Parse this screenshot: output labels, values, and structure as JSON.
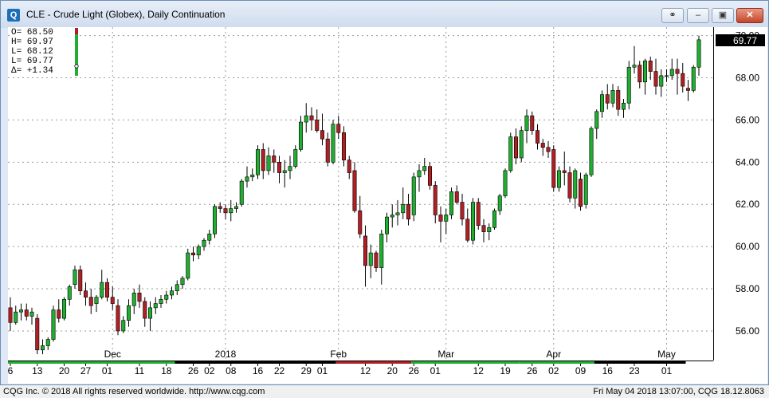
{
  "window": {
    "title": "CLE - Crude Light (Globex), Daily Continuation",
    "app_icon_glyph": "Q",
    "buttons": [
      "link-icon",
      "minimize-icon",
      "restore-icon",
      "close-icon"
    ]
  },
  "ohlc_box": {
    "lines": [
      "O=  68.50",
      "H=  69.97",
      "L=  68.12",
      "L=  69.77",
      "Δ=  +1.34"
    ]
  },
  "last_price": "69.77",
  "status": {
    "left": "CQG Inc. © 2018 All rights reserved worldwide. http://www.cqg.com",
    "right": "Fri May 04 2018 13:07:00, CQG 18.12.8063"
  },
  "colors": {
    "up": "#1fae2f",
    "down": "#b01f24",
    "wick": "#000000",
    "grid": "#9a9a9a"
  },
  "chart_data": {
    "type": "candlestick",
    "symbol": "CLE",
    "ylim": [
      54.6,
      70.4
    ],
    "y_ticks": [
      "56.00",
      "58.00",
      "60.00",
      "62.00",
      "64.00",
      "66.00",
      "68.00",
      "70.00"
    ],
    "month_labels": [
      {
        "label": "Dec",
        "bar": 19
      },
      {
        "label": "2018",
        "bar": 40
      },
      {
        "label": "Feb",
        "bar": 61
      },
      {
        "label": "Mar",
        "bar": 81
      },
      {
        "label": "Apr",
        "bar": 101
      },
      {
        "label": "May",
        "bar": 122
      }
    ],
    "day_labels": [
      {
        "label": "6",
        "bar": 0
      },
      {
        "label": "13",
        "bar": 5
      },
      {
        "label": "20",
        "bar": 10
      },
      {
        "label": "27",
        "bar": 14
      },
      {
        "label": "01",
        "bar": 18
      },
      {
        "label": "11",
        "bar": 24
      },
      {
        "label": "18",
        "bar": 29
      },
      {
        "label": "26",
        "bar": 34
      },
      {
        "label": "02",
        "bar": 37
      },
      {
        "label": "08",
        "bar": 41
      },
      {
        "label": "16",
        "bar": 46
      },
      {
        "label": "22",
        "bar": 50
      },
      {
        "label": "29",
        "bar": 55
      },
      {
        "label": "01",
        "bar": 58
      },
      {
        "label": "12",
        "bar": 66
      },
      {
        "label": "20",
        "bar": 71
      },
      {
        "label": "26",
        "bar": 75
      },
      {
        "label": "01",
        "bar": 79
      },
      {
        "label": "12",
        "bar": 87
      },
      {
        "label": "19",
        "bar": 92
      },
      {
        "label": "26",
        "bar": 97
      },
      {
        "label": "02",
        "bar": 101
      },
      {
        "label": "09",
        "bar": 106
      },
      {
        "label": "16",
        "bar": 111
      },
      {
        "label": "23",
        "bar": 116
      },
      {
        "label": "01",
        "bar": 122
      }
    ],
    "candles": [
      [
        57.1,
        57.6,
        56.0,
        56.4
      ],
      [
        56.4,
        57.2,
        56.3,
        56.9
      ],
      [
        56.9,
        57.3,
        56.5,
        57.0
      ],
      [
        57.0,
        57.3,
        56.5,
        56.7
      ],
      [
        56.7,
        57.1,
        56.3,
        56.9
      ],
      [
        56.6,
        56.8,
        54.9,
        55.1
      ],
      [
        55.1,
        55.6,
        54.9,
        55.3
      ],
      [
        55.3,
        55.7,
        55.1,
        55.6
      ],
      [
        55.6,
        57.2,
        55.5,
        57.0
      ],
      [
        57.0,
        57.5,
        56.4,
        56.6
      ],
      [
        56.6,
        57.6,
        56.5,
        57.5
      ],
      [
        57.5,
        58.2,
        57.2,
        58.1
      ],
      [
        58.2,
        59.1,
        58.0,
        58.9
      ],
      [
        58.9,
        59.1,
        57.7,
        57.9
      ],
      [
        57.9,
        58.3,
        57.2,
        57.6
      ],
      [
        57.6,
        58.0,
        56.8,
        57.2
      ],
      [
        57.3,
        57.7,
        56.9,
        57.6
      ],
      [
        57.6,
        58.9,
        57.5,
        58.3
      ],
      [
        58.3,
        58.5,
        57.4,
        57.6
      ],
      [
        57.6,
        58.1,
        57.0,
        57.3
      ],
      [
        57.2,
        57.5,
        55.8,
        56.0
      ],
      [
        56.0,
        56.7,
        55.9,
        56.5
      ],
      [
        56.5,
        57.5,
        56.2,
        57.2
      ],
      [
        57.2,
        58.0,
        56.8,
        57.8
      ],
      [
        57.8,
        58.2,
        57.1,
        57.4
      ],
      [
        57.4,
        57.6,
        56.2,
        56.6
      ],
      [
        56.6,
        57.4,
        56.0,
        57.1
      ],
      [
        57.1,
        57.6,
        56.8,
        57.3
      ],
      [
        57.3,
        57.7,
        57.1,
        57.5
      ],
      [
        57.5,
        57.9,
        57.3,
        57.7
      ],
      [
        57.7,
        58.1,
        57.5,
        57.9
      ],
      [
        57.9,
        58.4,
        57.7,
        58.2
      ],
      [
        58.2,
        58.6,
        58.0,
        58.5
      ],
      [
        58.5,
        59.9,
        58.4,
        59.7
      ],
      [
        59.7,
        60.0,
        59.3,
        59.6
      ],
      [
        59.6,
        60.1,
        59.4,
        60.0
      ],
      [
        60.0,
        60.4,
        59.8,
        60.3
      ],
      [
        60.3,
        60.8,
        60.1,
        60.6
      ],
      [
        60.6,
        62.0,
        60.4,
        61.9
      ],
      [
        61.9,
        62.1,
        61.6,
        61.8
      ],
      [
        61.8,
        62.0,
        61.3,
        61.6
      ],
      [
        61.6,
        62.2,
        61.2,
        61.8
      ],
      [
        61.8,
        62.1,
        61.6,
        61.9
      ],
      [
        62.0,
        63.2,
        61.9,
        63.1
      ],
      [
        63.1,
        63.8,
        62.8,
        63.3
      ],
      [
        63.3,
        63.7,
        63.1,
        63.4
      ],
      [
        63.4,
        64.8,
        63.2,
        64.6
      ],
      [
        64.6,
        64.9,
        63.2,
        63.6
      ],
      [
        63.6,
        64.7,
        63.4,
        64.3
      ],
      [
        64.3,
        64.6,
        63.5,
        64.0
      ],
      [
        64.0,
        64.3,
        63.0,
        63.5
      ],
      [
        63.5,
        64.1,
        62.8,
        63.6
      ],
      [
        63.6,
        64.3,
        63.2,
        63.8
      ],
      [
        63.8,
        64.8,
        63.7,
        64.6
      ],
      [
        64.6,
        66.2,
        64.5,
        65.9
      ],
      [
        65.9,
        66.8,
        65.4,
        66.2
      ],
      [
        66.2,
        66.6,
        65.5,
        66.0
      ],
      [
        66.0,
        66.5,
        65.4,
        65.5
      ],
      [
        65.5,
        66.3,
        64.8,
        65.1
      ],
      [
        65.1,
        65.4,
        63.8,
        64.0
      ],
      [
        64.0,
        66.0,
        63.9,
        65.8
      ],
      [
        65.8,
        66.2,
        65.1,
        65.4
      ],
      [
        65.4,
        65.7,
        63.8,
        64.1
      ],
      [
        64.1,
        64.3,
        63.2,
        63.5
      ],
      [
        63.6,
        64.0,
        61.6,
        61.7
      ],
      [
        61.7,
        62.4,
        60.4,
        60.6
      ],
      [
        60.5,
        61.0,
        58.1,
        59.1
      ],
      [
        59.1,
        60.1,
        58.5,
        59.7
      ],
      [
        59.7,
        59.8,
        58.8,
        59.0
      ],
      [
        59.0,
        60.8,
        58.2,
        60.6
      ],
      [
        60.6,
        61.6,
        60.2,
        61.4
      ],
      [
        61.4,
        62.0,
        60.9,
        61.5
      ],
      [
        61.5,
        62.2,
        61.0,
        61.6
      ],
      [
        61.6,
        62.8,
        61.3,
        62.0
      ],
      [
        62.0,
        62.5,
        61.0,
        61.3
      ],
      [
        61.5,
        63.5,
        61.2,
        63.3
      ],
      [
        63.3,
        63.9,
        62.6,
        63.6
      ],
      [
        63.6,
        64.2,
        63.4,
        63.8
      ],
      [
        63.8,
        64.0,
        62.7,
        62.9
      ],
      [
        62.9,
        63.1,
        61.1,
        61.5
      ],
      [
        61.5,
        61.9,
        60.2,
        61.2
      ],
      [
        61.2,
        61.8,
        60.6,
        61.5
      ],
      [
        61.5,
        62.8,
        61.3,
        62.6
      ],
      [
        62.6,
        62.9,
        62.0,
        62.1
      ],
      [
        62.1,
        62.5,
        61.0,
        61.3
      ],
      [
        61.3,
        61.8,
        60.2,
        60.3
      ],
      [
        60.3,
        62.3,
        60.1,
        62.1
      ],
      [
        62.1,
        62.3,
        60.8,
        61.0
      ],
      [
        61.0,
        61.3,
        60.2,
        60.7
      ],
      [
        60.7,
        61.1,
        60.3,
        60.9
      ],
      [
        60.9,
        61.8,
        60.8,
        61.7
      ],
      [
        61.7,
        62.5,
        61.5,
        62.4
      ],
      [
        62.4,
        63.7,
        62.3,
        63.6
      ],
      [
        63.6,
        65.4,
        63.5,
        65.2
      ],
      [
        65.2,
        65.6,
        63.9,
        64.2
      ],
      [
        64.2,
        65.7,
        64.0,
        65.5
      ],
      [
        65.5,
        66.5,
        64.9,
        66.2
      ],
      [
        66.2,
        66.4,
        65.3,
        65.5
      ],
      [
        65.5,
        65.8,
        64.6,
        64.9
      ],
      [
        64.9,
        65.1,
        64.3,
        64.7
      ],
      [
        64.7,
        65.0,
        64.2,
        64.5
      ],
      [
        64.6,
        64.8,
        62.6,
        62.8
      ],
      [
        62.8,
        63.8,
        62.6,
        63.6
      ],
      [
        63.6,
        64.5,
        62.9,
        63.5
      ],
      [
        63.5,
        63.8,
        62.1,
        62.3
      ],
      [
        62.3,
        63.7,
        61.8,
        63.6
      ],
      [
        63.2,
        63.5,
        61.7,
        61.9
      ],
      [
        62.0,
        63.5,
        61.8,
        63.4
      ],
      [
        63.4,
        65.7,
        63.3,
        65.6
      ],
      [
        65.6,
        66.5,
        65.1,
        66.4
      ],
      [
        66.4,
        67.4,
        66.1,
        67.2
      ],
      [
        67.2,
        67.7,
        66.5,
        66.8
      ],
      [
        66.8,
        67.7,
        66.6,
        67.4
      ],
      [
        67.4,
        67.6,
        66.2,
        66.5
      ],
      [
        66.5,
        67.0,
        66.1,
        66.8
      ],
      [
        66.8,
        68.8,
        66.5,
        68.5
      ],
      [
        68.5,
        69.5,
        68.2,
        68.6
      ],
      [
        68.6,
        68.8,
        67.5,
        67.8
      ],
      [
        67.8,
        68.9,
        67.2,
        68.8
      ],
      [
        68.8,
        69.0,
        67.9,
        68.3
      ],
      [
        68.3,
        68.9,
        67.2,
        67.6
      ],
      [
        67.6,
        68.4,
        67.1,
        68.1
      ],
      [
        68.1,
        68.4,
        67.8,
        68.1
      ],
      [
        68.1,
        68.9,
        67.9,
        68.4
      ],
      [
        68.4,
        68.9,
        67.2,
        68.2
      ],
      [
        68.2,
        68.7,
        67.3,
        67.6
      ],
      [
        67.5,
        67.9,
        66.9,
        67.4
      ],
      [
        67.4,
        68.6,
        67.3,
        68.5
      ],
      [
        68.5,
        70.0,
        68.1,
        69.8
      ]
    ],
    "legend_bars": [
      {
        "from": 0,
        "to": 30,
        "color": "#1fae2f"
      },
      {
        "from": 31,
        "to": 60,
        "color": "#000000"
      },
      {
        "from": 61,
        "to": 74,
        "color": "#b01f24"
      },
      {
        "from": 75,
        "to": 94,
        "color": "#1fae2f"
      },
      {
        "from": 95,
        "to": 108,
        "color": "#1fae2f"
      },
      {
        "from": 109,
        "to": 125,
        "color": "#000000"
      }
    ]
  }
}
